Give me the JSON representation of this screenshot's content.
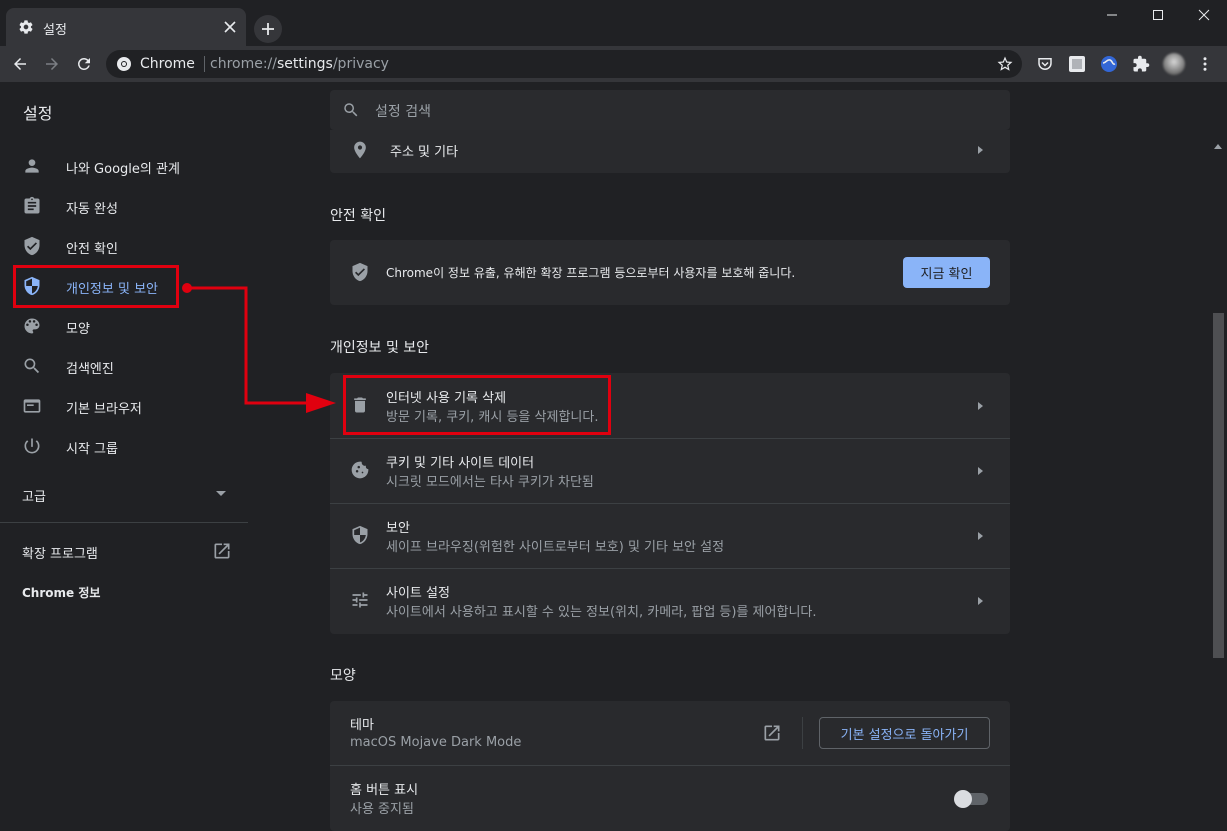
{
  "browser": {
    "tab_title": "설정",
    "site_name": "Chrome",
    "url_prefix": "chrome://",
    "url_host": "settings",
    "url_path": "/privacy"
  },
  "header": {
    "title": "설정",
    "search_placeholder": "설정 검색"
  },
  "sidebar": {
    "items": [
      {
        "label": "나와 Google의 관계",
        "icon": "person-icon"
      },
      {
        "label": "자동 완성",
        "icon": "clipboard-icon"
      },
      {
        "label": "안전 확인",
        "icon": "shield-check-icon"
      },
      {
        "label": "개인정보 및 보안",
        "icon": "shield-privacy-icon"
      },
      {
        "label": "모양",
        "icon": "palette-icon"
      },
      {
        "label": "검색엔진",
        "icon": "search-icon"
      },
      {
        "label": "기본 브라우저",
        "icon": "browser-icon"
      },
      {
        "label": "시작 그룹",
        "icon": "power-icon"
      }
    ],
    "advanced": "고급",
    "extensions": "확장 프로그램",
    "about": "Chrome 정보"
  },
  "main": {
    "address_row": "주소 및 기타",
    "safety_title": "안전 확인",
    "safety_text": "Chrome이 정보 유출, 유해한 확장 프로그램 등으로부터 사용자를 보호해 줍니다.",
    "safety_button": "지금 확인",
    "privacy_title": "개인정보 및 보안",
    "privacy_rows": [
      {
        "title": "인터넷 사용 기록 삭제",
        "sub": "방문 기록, 쿠키, 캐시 등을 삭제합니다.",
        "icon": "trash-icon"
      },
      {
        "title": "쿠키 및 기타 사이트 데이터",
        "sub": "시크릿 모드에서는 타사 쿠키가 차단됨",
        "icon": "cookie-icon"
      },
      {
        "title": "보안",
        "sub": "세이프 브라우징(위험한 사이트로부터 보호) 및 기타 보안 설정",
        "icon": "security-shield-icon"
      },
      {
        "title": "사이트 설정",
        "sub": "사이트에서 사용하고 표시할 수 있는 정보(위치, 카메라, 팝업 등)를 제어합니다.",
        "icon": "tune-icon"
      }
    ],
    "appearance_title": "모양",
    "theme_title": "테마",
    "theme_sub": "macOS Mojave Dark Mode",
    "theme_button": "기본 설정으로 돌아가기",
    "home_title": "홈 버튼 표시",
    "home_sub": "사용 중지됨"
  },
  "colors": {
    "accent": "#8ab4f8",
    "annotation": "#e0000f",
    "background": "#202124",
    "card": "#292a2d"
  }
}
